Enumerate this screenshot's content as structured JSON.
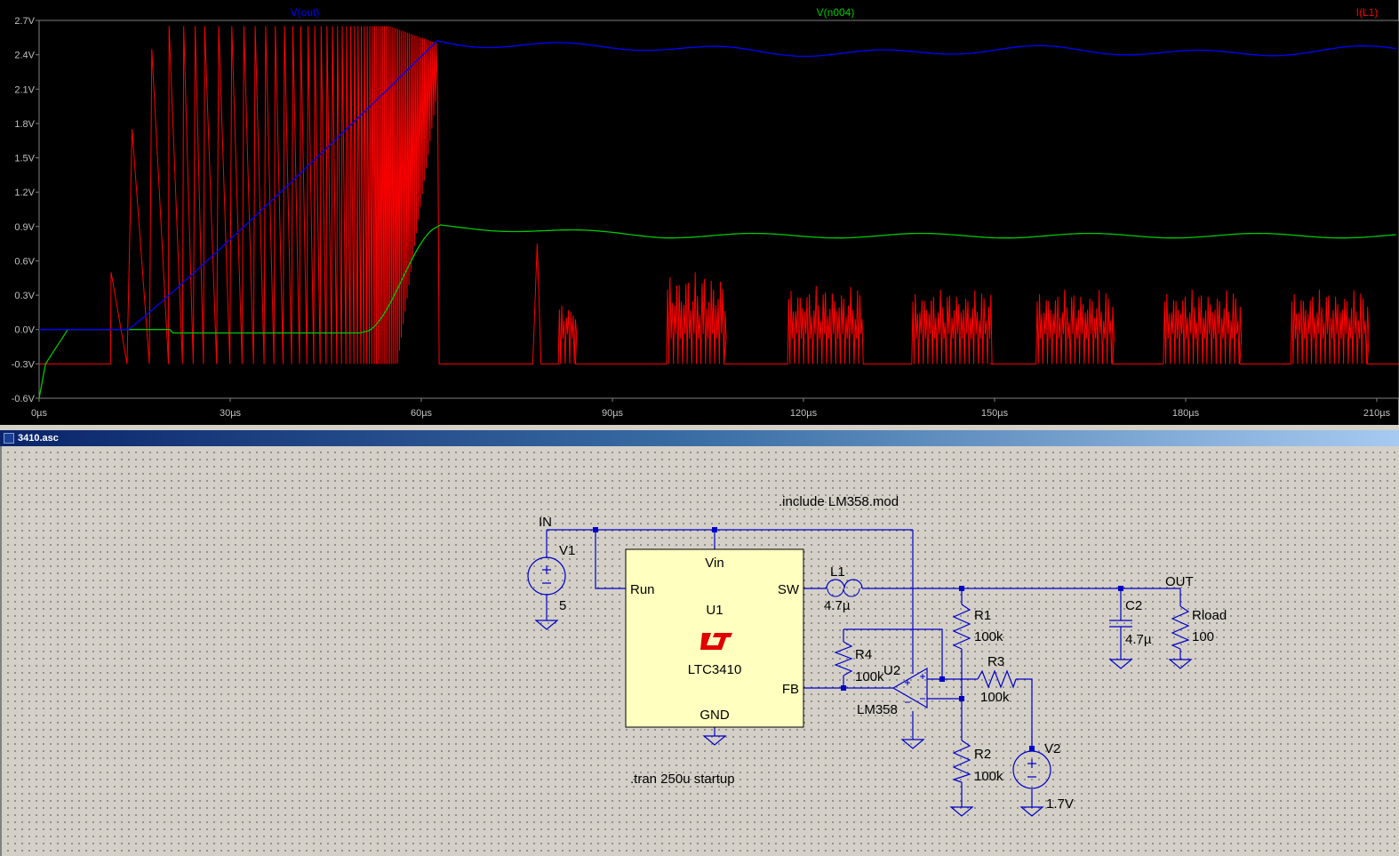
{
  "waveform": {
    "traces": {
      "vout": {
        "label": "V(out)",
        "color": "#0000ff"
      },
      "vn004": {
        "label": "V(n004)",
        "color": "#00c800"
      },
      "il1": {
        "label": "I(L1)",
        "color": "#ff0000"
      }
    },
    "y_ticks": [
      "2.7V",
      "2.4V",
      "2.1V",
      "1.8V",
      "1.5V",
      "1.2V",
      "0.9V",
      "0.6V",
      "0.3V",
      "0.0V",
      "-0.3V",
      "-0.6V"
    ],
    "x_ticks": [
      "0µs",
      "30µs",
      "60µs",
      "90µs",
      "120µs",
      "150µs",
      "180µs",
      "210µs"
    ]
  },
  "schematic": {
    "window_title": "3410.asc",
    "directives": {
      "include": ".include LM358.mod",
      "tran": ".tran 250u startup"
    },
    "nets": {
      "in": "IN",
      "out": "OUT"
    },
    "u1": {
      "ref": "U1",
      "part": "LTC3410",
      "pin_vin": "Vin",
      "pin_run": "Run",
      "pin_sw": "SW",
      "pin_fb": "FB",
      "pin_gnd": "GND"
    },
    "v1": {
      "ref": "V1",
      "value": "5"
    },
    "v2": {
      "ref": "V2",
      "value": "1.7V"
    },
    "l1": {
      "ref": "L1",
      "value": "4.7µ"
    },
    "c2": {
      "ref": "C2",
      "value": "4.7µ"
    },
    "rload": {
      "ref": "Rload",
      "value": "100"
    },
    "r1": {
      "ref": "R1",
      "value": "100k"
    },
    "r2": {
      "ref": "R2",
      "value": "100k"
    },
    "r3": {
      "ref": "R3",
      "value": "100k"
    },
    "r4": {
      "ref": "R4",
      "value": "100k"
    },
    "u2": {
      "ref": "U2",
      "part": "LM358"
    }
  }
}
